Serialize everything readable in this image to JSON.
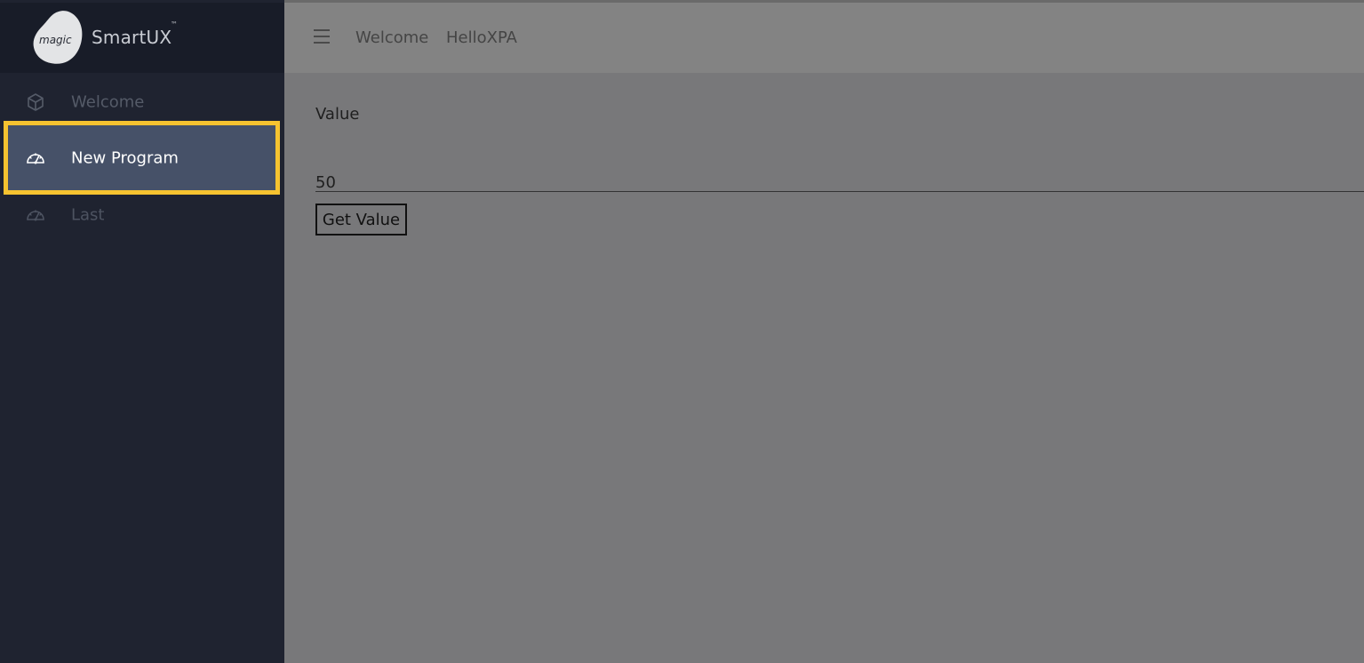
{
  "brand": {
    "logo_text": "magic",
    "name": "SmartUX",
    "trademark": "™"
  },
  "sidebar": {
    "items": [
      {
        "label": "Welcome",
        "icon": "cube-icon",
        "state": "dimmed"
      },
      {
        "label": "New Program",
        "icon": "speedometer-icon",
        "state": "selected"
      },
      {
        "label": "Last",
        "icon": "speedometer-icon",
        "state": "dimmed"
      }
    ],
    "highlight_color": "#f6c330",
    "active_bg": "#465168"
  },
  "header": {
    "menu_icon": "hamburger-icon",
    "breadcrumbs": [
      "Welcome",
      "HelloXPA"
    ]
  },
  "main": {
    "field_label": "Value",
    "field_value": "50",
    "button_label": "Get Value"
  }
}
